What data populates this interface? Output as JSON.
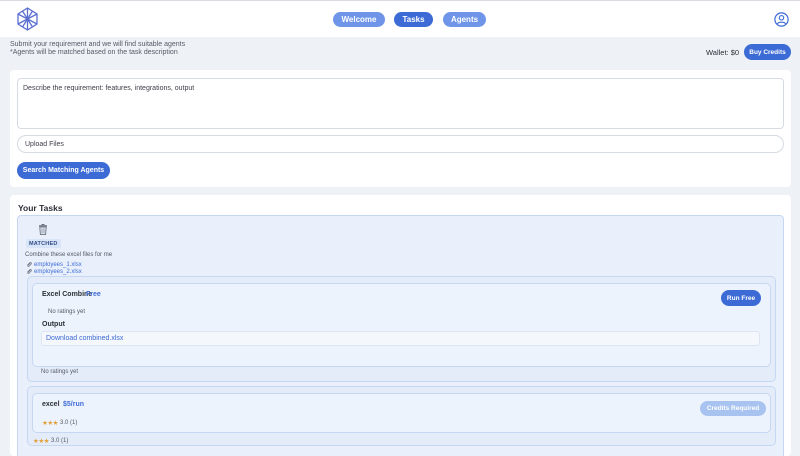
{
  "nav": {
    "tabs": [
      {
        "label": "Welcome"
      },
      {
        "label": "Tasks"
      },
      {
        "label": "Agents"
      }
    ]
  },
  "intro": {
    "line1": "Submit your requirement and we will find suitable agents",
    "line2": "*Agents will be matched based on the task description"
  },
  "wallet": {
    "label": "Wallet: $0",
    "buy_label": "Buy Credits"
  },
  "form": {
    "requirement_placeholder": "Describe the requirement: features, integrations, output",
    "upload_label": "Upload Files",
    "search_label": "Search Matching Agents"
  },
  "tasks": {
    "title": "Your Tasks",
    "items": [
      {
        "status": "MATCHED",
        "description": "Combine these excel files for me",
        "files": [
          "employees_1.xlsx",
          "employees_2.xlsx"
        ],
        "agents": [
          {
            "name": "Excel Combine",
            "price": "Free",
            "action_label": "Run Free",
            "inner_rating": "No ratings yet",
            "output_label": "Output",
            "output_link": "Download combined.xlsx",
            "outer_rating": "No ratings yet"
          },
          {
            "name": "excel",
            "price": "$5/run",
            "action_label": "Credits Required",
            "stars": "★★★",
            "inner_rating": "3.0 (1)",
            "outer_rating": "3.0 (1)"
          }
        ]
      }
    ]
  },
  "colors": {
    "primary": "#3d6bd6",
    "nav_inactive": "#6f95e8",
    "disabled": "#a9c3f0",
    "star": "#e2a03a",
    "card_tint": "#e9f0fb"
  }
}
